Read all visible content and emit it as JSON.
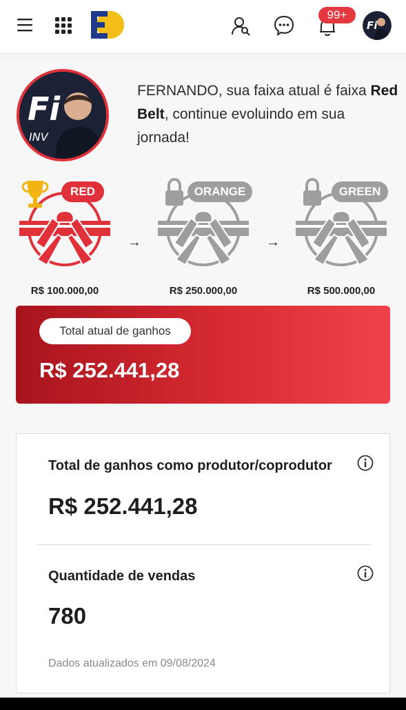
{
  "header": {
    "menu_icon": "hamburger-menu-icon",
    "apps_icon": "apps-grid-icon",
    "logo_icon": "brand-logo-icon",
    "people_icon": "user-search-icon",
    "chat_icon": "chat-bubble-icon",
    "bell_icon": "notification-bell-icon",
    "notification_count": "99+",
    "avatar_icon": "user-avatar-icon"
  },
  "profile": {
    "name": "FERNANDO",
    "message_prefix": ", sua faixa atual é faixa ",
    "belt_name": "Red Belt",
    "message_suffix": ", continue evoluindo em sua jornada!",
    "avatar_text": "INV"
  },
  "belts": [
    {
      "label": "RED",
      "value": "R$ 100.000,00",
      "status": "achieved",
      "color": "#e0313a",
      "icon": "trophy-icon"
    },
    {
      "label": "ORANGE",
      "value": "R$ 250.000,00",
      "status": "locked",
      "color": "#9e9e9e",
      "icon": "lock-icon"
    },
    {
      "label": "GREEN",
      "value": "R$ 500.000,00",
      "status": "locked",
      "color": "#9e9e9e",
      "icon": "lock-icon"
    }
  ],
  "arrows": [
    "→",
    "→"
  ],
  "total_card": {
    "label": "Total atual de ganhos",
    "value": "R$ 252.441,28"
  },
  "stats": {
    "producer_label": "Total de ganhos como produtor/coprodutor",
    "producer_value": "R$ 252.441,28",
    "sales_label": "Quantidade de vendas",
    "sales_value": "780",
    "updated": "Dados atualizados em 09/08/2024"
  },
  "colors": {
    "accent": "#e0313a",
    "card_gradient_start": "#a8141c",
    "card_gradient_end": "#f0424a",
    "locked": "#9e9e9e"
  }
}
